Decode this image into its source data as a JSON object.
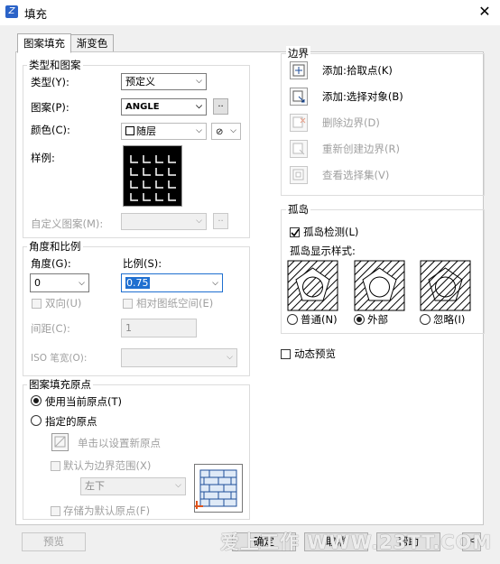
{
  "window": {
    "title": "填充",
    "close": "✕"
  },
  "tabs": [
    "图案填充",
    "渐变色"
  ],
  "type_group": {
    "title": "类型和图案",
    "type_label": "类型(Y):",
    "type_value": "预定义",
    "pattern_label": "图案(P):",
    "pattern_value": "ANGLE",
    "pattern_browse": "..",
    "color_label": "颜色(C):",
    "color_value": "随层",
    "swatch_label": "样例:",
    "custom_label": "自定义图案(M):",
    "custom_browse": ".."
  },
  "angle_group": {
    "title": "角度和比例",
    "angle_label": "角度(G):",
    "angle_value": "0",
    "scale_label": "比例(S):",
    "scale_value": "0.75",
    "double_label": "双向(U)",
    "relative_label": "相对图纸空间(E)",
    "spacing_label": "间距(C):",
    "spacing_value": "1",
    "iso_label": "ISO 笔宽(O):"
  },
  "origin_group": {
    "title": "图案填充原点",
    "use_current": "使用当前原点(T)",
    "specified": "指定的原点",
    "click_set": "单击以设置新原点",
    "default_boundary": "默认为边界范围(X)",
    "position_value": "左下",
    "store_default": "存储为默认原点(F)"
  },
  "boundary_group": {
    "title": "边界",
    "add_pick": "添加:拾取点(K)",
    "add_select": "添加:选择对象(B)",
    "remove": "删除边界(D)",
    "recreate": "重新创建边界(R)",
    "view_selection": "查看选择集(V)"
  },
  "island_group": {
    "title": "孤岛",
    "detect_label": "孤岛检测(L)",
    "style_label": "孤岛显示样式:",
    "styles": [
      "普通(N)",
      "外部",
      "忽略(I)"
    ]
  },
  "dynamic_preview": "动态预览",
  "bottom": {
    "preview": "预览",
    "ok": "确定",
    "cancel": "取消",
    "help": "帮助"
  },
  "watermark": "爱上工作 WWW.23TT.COM"
}
